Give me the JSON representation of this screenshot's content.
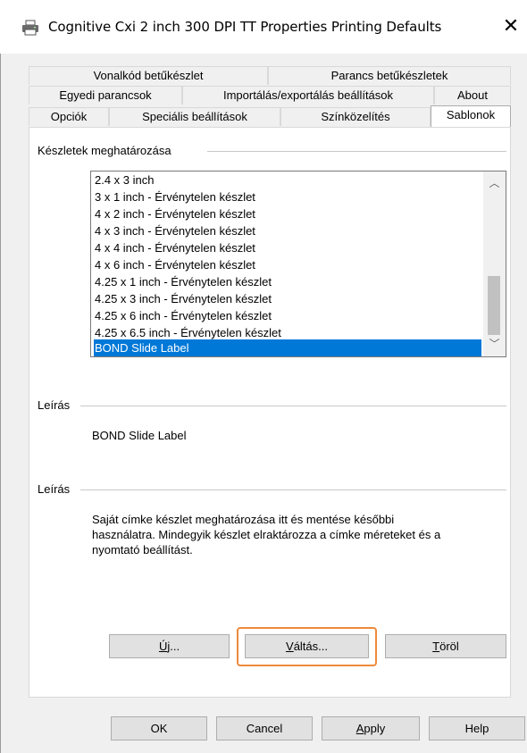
{
  "window": {
    "title": "Cognitive Cxi 2 inch 300 DPI TT Properties Printing Defaults",
    "close_glyph": "✕",
    "icon": "printer-icon"
  },
  "tabs": {
    "row1": [
      "Vonalkód betűkészlet",
      "Parancs betűkészletek"
    ],
    "row2": [
      "Egyedi parancsok",
      "Importálás/exportálás beállítások",
      "About"
    ],
    "row3": [
      "Opciók",
      "Speciális beállítások",
      "Színközelítés",
      "Sablonok"
    ],
    "active": "Sablonok"
  },
  "sets_group": {
    "label": "Készletek meghatározása",
    "items": [
      "2.4 x 3 inch",
      "3 x 1 inch - Érvénytelen készlet",
      "4 x 2 inch - Érvénytelen készlet",
      "4 x 3 inch - Érvénytelen készlet",
      "4 x 4 inch - Érvénytelen készlet",
      "4 x 6 inch - Érvénytelen készlet",
      "4.25 x 1 inch - Érvénytelen készlet",
      "4.25 x 3 inch - Érvénytelen készlet",
      "4.25 x 6 inch - Érvénytelen készlet",
      "4.25 x 6.5 inch - Érvénytelen készlet",
      "BOND Slide Label"
    ],
    "selected": "BOND Slide Label"
  },
  "description1": {
    "label": "Leírás",
    "text": "BOND Slide Label"
  },
  "description2": {
    "label": "Leírás",
    "lines": [
      "Saját címke készlet meghatározása itt és mentése későbbi",
      "használatra. Mindegyik készlet elraktározza a címke méreteket és a",
      "nyomtató beállítást."
    ]
  },
  "action_buttons": {
    "new": {
      "label": "Új...",
      "accel": "Ú",
      "rest": "j..."
    },
    "change": {
      "label": "Váltás...",
      "accel": "V",
      "rest": "áltás..."
    },
    "delete": {
      "label": "Töröl",
      "accel": "T",
      "rest": "öröl"
    }
  },
  "dialog_buttons": {
    "ok": "OK",
    "cancel": "Cancel",
    "apply": {
      "label": "Apply",
      "accel": "A",
      "rest": "pply"
    },
    "help": "Help"
  },
  "colors": {
    "selection": "#0078d7",
    "highlight": "#ee8a3c"
  }
}
